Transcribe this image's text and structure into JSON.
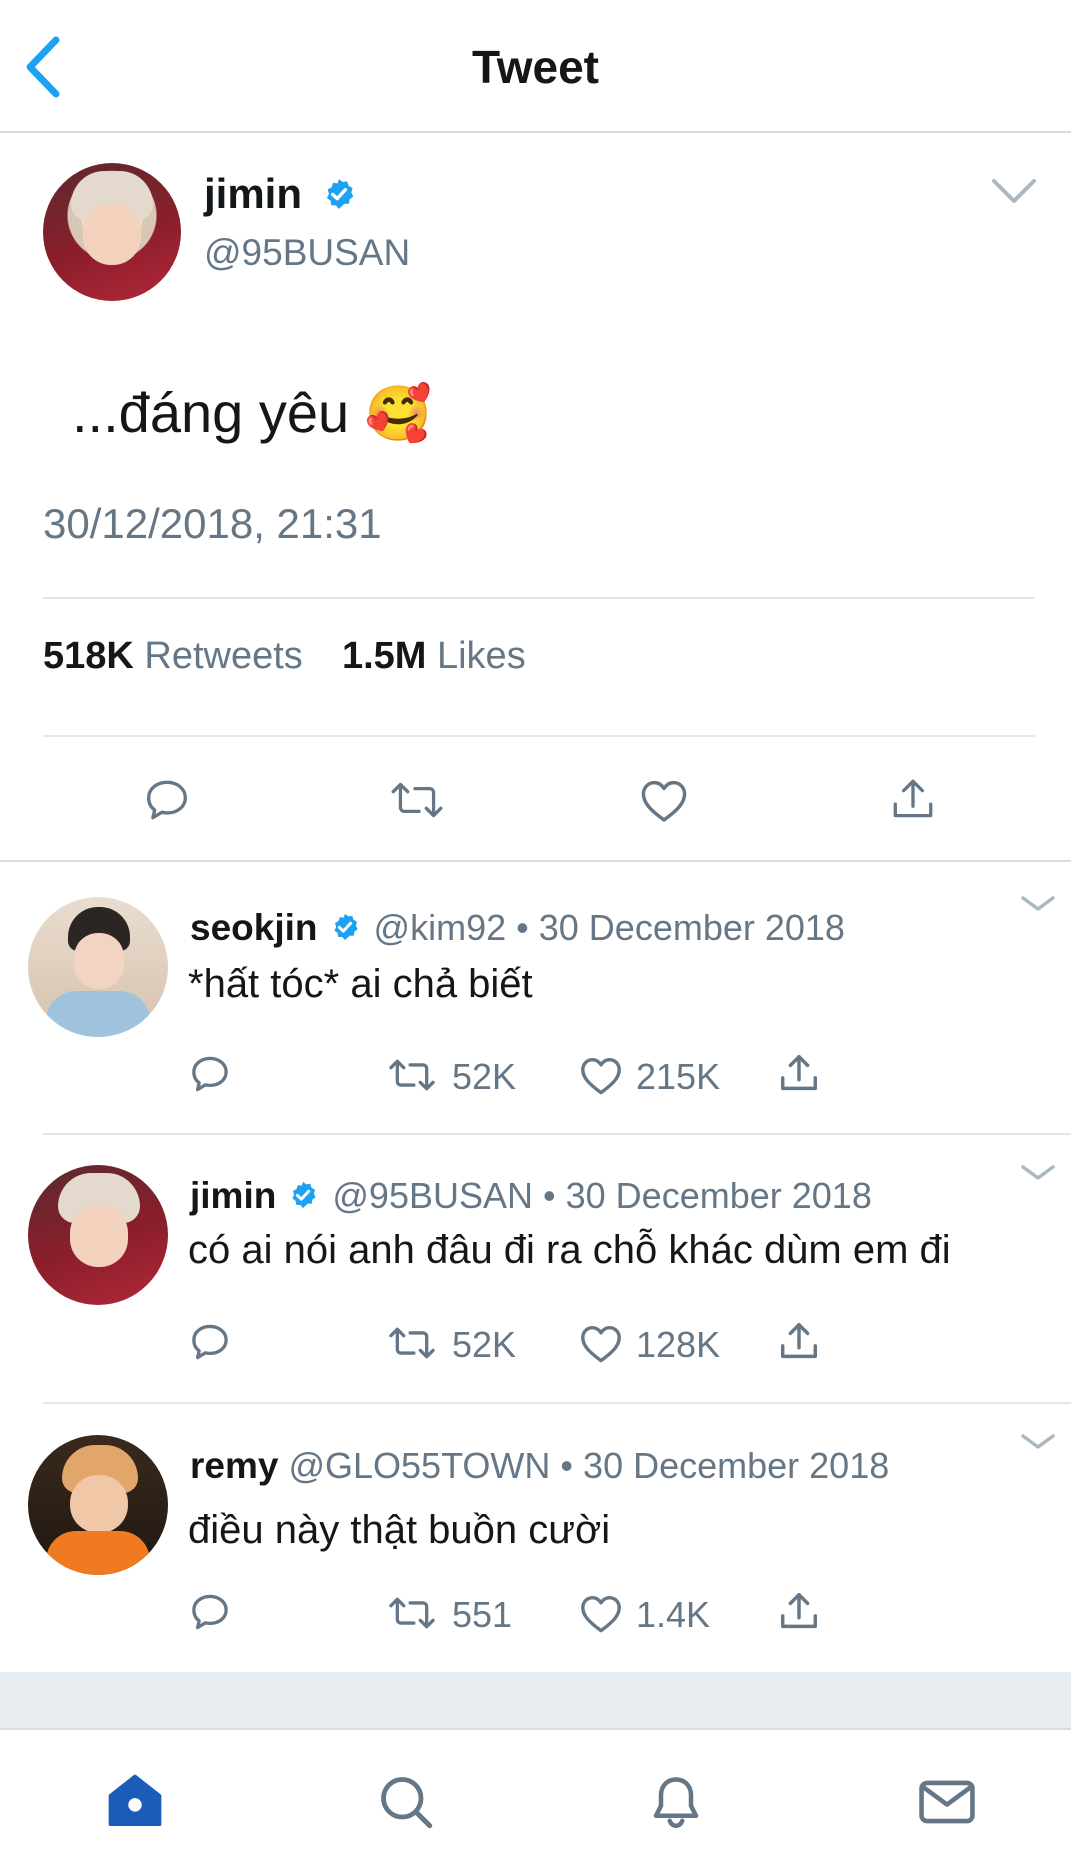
{
  "header": {
    "title": "Tweet"
  },
  "main_tweet": {
    "name": "jimin",
    "handle": "@95BUSAN",
    "text": "...đáng yêu",
    "emoji": "🥰",
    "timestamp": "30/12/2018, 21:31",
    "retweets_count": "518K",
    "retweets_label": "Retweets",
    "likes_count": "1.5M",
    "likes_label": "Likes"
  },
  "replies": [
    {
      "name": "seokjin",
      "handle": "@kim92",
      "separator": "•",
      "date": "30 December 2018",
      "text": "*hất tóc* ai chả biết",
      "retweets": "52K",
      "likes": "215K"
    },
    {
      "name": "jimin",
      "handle": "@95BUSAN",
      "separator": "•",
      "date": "30 December 2018",
      "text": "có ai nói anh đâu đi ra chỗ khác dùm em đi",
      "retweets": "52K",
      "likes": "128K"
    },
    {
      "name": "remy",
      "handle": "@GLO55TOWN",
      "separator": "•",
      "date": "30 December 2018",
      "text": "điều này thật buồn cười",
      "retweets": "551",
      "likes": "1.4K"
    }
  ],
  "tabs": [
    {
      "icon": "home-icon",
      "active": true
    },
    {
      "icon": "search-icon",
      "active": false
    },
    {
      "icon": "bell-icon",
      "active": false
    },
    {
      "icon": "mail-icon",
      "active": false
    }
  ],
  "colors": {
    "accent": "#1da1f2",
    "tab_active": "#1b5cb8",
    "verified": "#1da1f2",
    "muted": "#657786",
    "text": "#14171a"
  }
}
